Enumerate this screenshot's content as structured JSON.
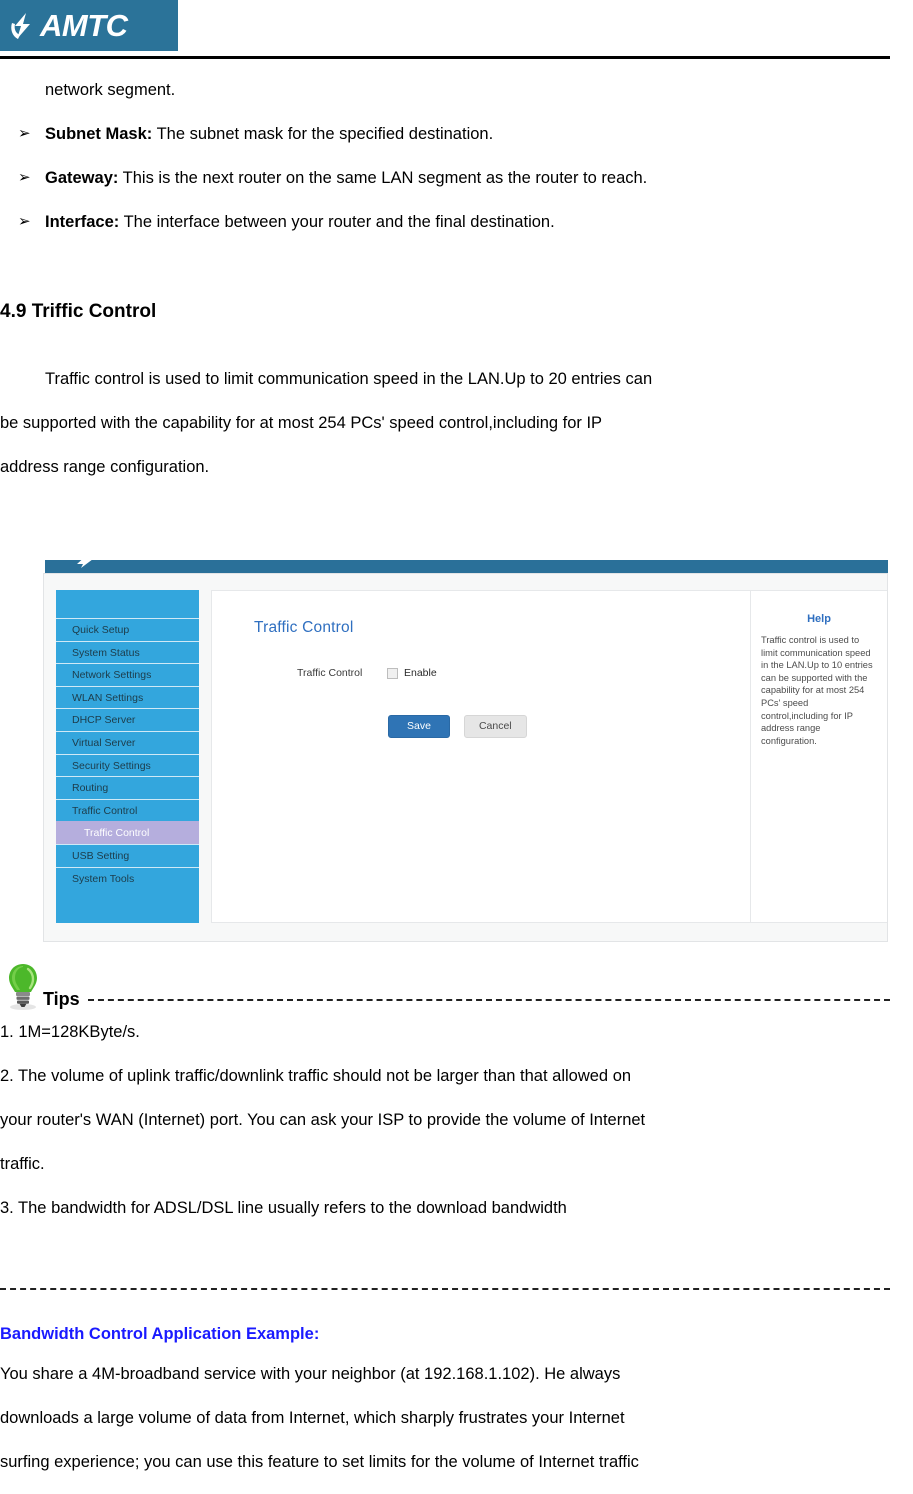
{
  "header": {
    "brand_name": "AMTC",
    "logo_icon": "amtc-flash-logo"
  },
  "document": {
    "continued_line": "network segment.",
    "bullets": [
      {
        "glyph": "➢",
        "term": "Subnet Mask:",
        "text": " The subnet mask for the specified destination."
      },
      {
        "glyph": "➢",
        "term": "Gateway:",
        "text": " This is the next router on the same LAN segment as the router to reach."
      },
      {
        "glyph": "➢",
        "term": "Interface:",
        "text": " The interface between your router and the final destination."
      }
    ],
    "section_title": "4.9 Triffic Control",
    "section_paragraph_1": "Traffic control is used to limit communication speed in the LAN.Up to 20 entries can",
    "section_paragraph_2": "be supported with the capability for at most 254 PCs' speed control,including for IP",
    "section_paragraph_3": "address range configuration."
  },
  "router_ui": {
    "sidebar": {
      "items": [
        {
          "label": "Quick Setup",
          "selected": false
        },
        {
          "label": "System Status",
          "selected": false
        },
        {
          "label": "Network Settings",
          "selected": false
        },
        {
          "label": "WLAN Settings",
          "selected": false
        },
        {
          "label": "DHCP Server",
          "selected": false
        },
        {
          "label": "Virtual Server",
          "selected": false
        },
        {
          "label": "Security Settings",
          "selected": false
        },
        {
          "label": "Routing",
          "selected": false
        },
        {
          "label": "Traffic Control",
          "selected": false
        },
        {
          "label": "Traffic Control",
          "selected": true
        },
        {
          "label": "USB Setting",
          "selected": false
        },
        {
          "label": "System Tools",
          "selected": false
        }
      ]
    },
    "panel": {
      "title": "Traffic Control",
      "field_label": "Traffic Control",
      "checkbox_label": "Enable",
      "checkbox_checked": false,
      "save_label": "Save",
      "cancel_label": "Cancel"
    },
    "help": {
      "title": "Help",
      "text": "Traffic control is used to limit communication speed in the LAN.Up to 10 entries can be supported with the capability for at most 254 PCs' speed control,including for IP address range configuration."
    },
    "colors": {
      "topbar": "#2a7099",
      "sidebar": "#33a6dd",
      "sidebar_selected": "#b5aedd",
      "save_button": "#2f74b5",
      "cancel_button": "#e6e6e6",
      "title_blue": "#2f6fc0"
    }
  },
  "tips": {
    "icon": "lightbulb-icon",
    "heading": "Tips",
    "items": [
      "1. 1M=128KByte/s.",
      "2. The volume of uplink traffic/downlink traffic should not be larger than that allowed on",
      "your router's WAN (Internet) port. You can ask your ISP to provide the volume of Internet",
      "traffic.",
      "3. The bandwidth for ADSL/DSL line usually refers to the download bandwidth"
    ]
  },
  "example": {
    "heading": "Bandwidth Control Application Example:",
    "heading_color": "#1a1aff",
    "lines": [
      "You share a 4M-broadband service with your neighbor (at 192.168.1.102). He always",
      "downloads a large volume of data from Internet, which sharply frustrates your Internet",
      "surfing experience; you can use this feature to set limits for the volume of Internet traffic"
    ]
  }
}
